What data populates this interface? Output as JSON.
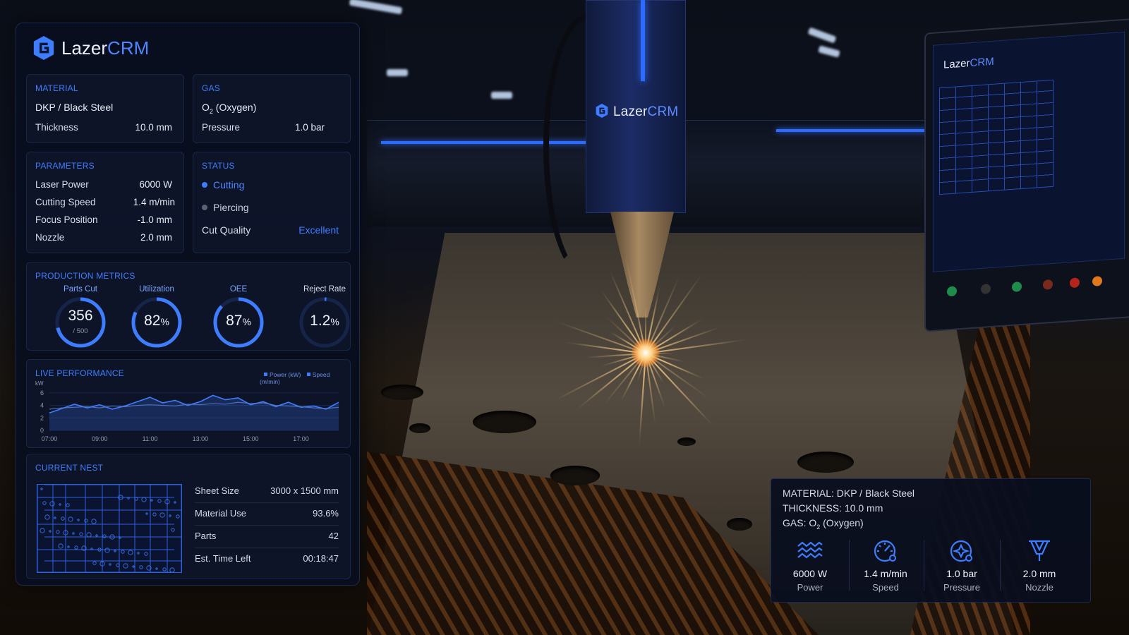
{
  "app": {
    "brand_left": "Lazer",
    "brand_right": "CRM"
  },
  "material_card": {
    "title": "MATERIAL",
    "value": "DKP / Black Steel",
    "thickness_label": "Thickness",
    "thickness_value": "10.0 mm"
  },
  "gas_card": {
    "title": "GAS",
    "gas_symbol": "O",
    "gas_subscript": "2",
    "gas_name": " (Oxygen)",
    "pressure_label": "Pressure",
    "pressure_value": "1.0 bar"
  },
  "parameters": {
    "title": "PARAMETERS",
    "rows": [
      {
        "label": "Laser Power",
        "value": "6000 W"
      },
      {
        "label": "Cutting Speed",
        "value": "1.4 m/min"
      },
      {
        "label": "Focus Position",
        "value": "-1.0 mm"
      },
      {
        "label": "Nozzle",
        "value": "2.0 mm"
      }
    ]
  },
  "status": {
    "title": "STATUS",
    "states": [
      {
        "label": "Cutting",
        "active": true
      },
      {
        "label": "Piercing",
        "active": false
      }
    ],
    "quality_label": "Cut Quality",
    "quality_value": "Excellent"
  },
  "production_metrics": {
    "title": "PRODUCTION METRICS",
    "items": [
      {
        "label": "Parts Cut",
        "value": "356",
        "sub": "/ 500",
        "fraction": 0.712
      },
      {
        "label": "Utilization",
        "value": "82",
        "unit": "%",
        "fraction": 0.82
      },
      {
        "label": "OEE",
        "value": "87",
        "unit": "%",
        "fraction": 0.87
      },
      {
        "label": "Reject Rate",
        "value": "1.2",
        "unit": "%",
        "fraction": 0.012
      }
    ]
  },
  "live_performance": {
    "title": "LIVE PERFORMANCE",
    "legend_power": "Power (kW)",
    "legend_speed": "Speed (m/min)"
  },
  "chart_data": {
    "type": "line",
    "title": "LIVE PERFORMANCE",
    "ylabel": "kW",
    "ylim": [
      0,
      7
    ],
    "yticks": [
      "0",
      "2",
      "4",
      "6"
    ],
    "xticks": [
      "07:00",
      "09:00",
      "11:00",
      "13:00",
      "15:00",
      "17:00"
    ],
    "x": [
      7.0,
      7.5,
      8.0,
      8.5,
      9.0,
      9.5,
      10.0,
      10.5,
      11.0,
      11.5,
      12.0,
      12.5,
      13.0,
      13.5,
      14.0,
      14.5,
      15.0,
      15.5,
      16.0,
      16.5,
      17.0,
      17.5,
      18.0,
      18.5
    ],
    "series": [
      {
        "name": "Power (kW)",
        "values": [
          2.8,
          3.5,
          4.2,
          3.6,
          4.1,
          3.4,
          3.9,
          4.6,
          5.3,
          4.4,
          4.8,
          4.0,
          4.6,
          5.6,
          4.9,
          5.2,
          4.1,
          4.6,
          3.8,
          4.5,
          3.7,
          3.9,
          3.4,
          4.5
        ]
      },
      {
        "name": "Speed (m/min)",
        "values": [
          3.4,
          3.6,
          3.7,
          3.8,
          3.6,
          3.9,
          3.8,
          4.0,
          4.1,
          4.0,
          3.9,
          4.2,
          4.1,
          4.3,
          4.2,
          4.5,
          4.3,
          4.4,
          4.0,
          3.9,
          3.8,
          3.6,
          3.5,
          3.7
        ]
      }
    ]
  },
  "current_nest": {
    "title": "CURRENT NEST",
    "rows": [
      {
        "label": "Sheet Size",
        "value": "3000 x 1500 mm"
      },
      {
        "label": "Material Use",
        "value": "93.6%"
      },
      {
        "label": "Parts",
        "value": "42"
      },
      {
        "label": "Est. Time Left",
        "value": "00:18:47"
      }
    ]
  },
  "overlay": {
    "material_line": "MATERIAL: DKP / Black Steel",
    "thickness_line": "THICKNESS: 10.0 mm",
    "gas_prefix": "GAS: O",
    "gas_sub": "2",
    "gas_suffix": " (Oxygen)",
    "stats": [
      {
        "icon": "waves-icon",
        "value": "6000 W",
        "label": "Power"
      },
      {
        "icon": "speedometer-icon",
        "value": "1.4 m/min",
        "label": "Speed"
      },
      {
        "icon": "pressure-gauge-icon",
        "value": "1.0 bar",
        "label": "Pressure"
      },
      {
        "icon": "nozzle-icon",
        "value": "2.0 mm",
        "label": "Nozzle"
      }
    ]
  },
  "colors": {
    "accent": "#3f7dff",
    "panel_bg": "#090e1e",
    "spark": "#ffb35a"
  }
}
